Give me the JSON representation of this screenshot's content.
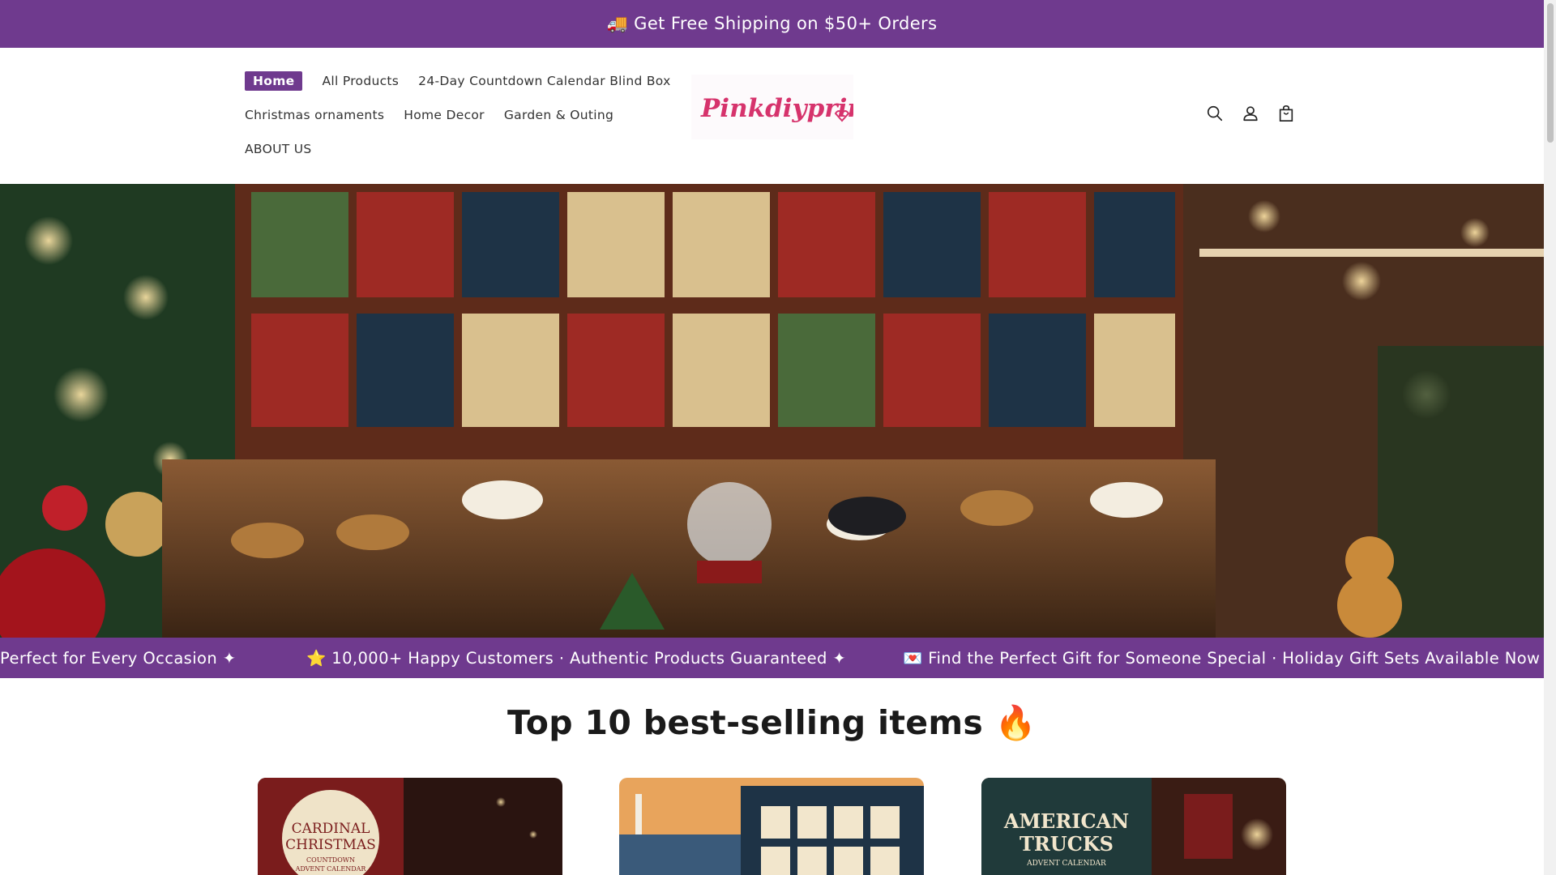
{
  "announcement": {
    "icon": "truck-icon",
    "text": "🚚 Get Free Shipping on $50+ Orders"
  },
  "nav": {
    "row1": [
      "Home",
      "All Products",
      "24-Day Countdown Calendar Blind Box"
    ],
    "row2": [
      "Christmas ornaments",
      "Home Decor",
      "Garden & Outing"
    ],
    "row3": [
      "ABOUT US"
    ]
  },
  "logo": {
    "text": "Pinkdiyprint"
  },
  "header_icons": [
    "search-icon",
    "account-icon",
    "cart-icon"
  ],
  "marquee": {
    "item1": "Perfect for Every Occasion ✦",
    "item2": "⭐ 10,000+ Happy Customers · Authentic Products Guaranteed ✦",
    "item3": "💌 Find the Perfect Gift for Someone Special · Holiday Gift Sets Available Now ✦"
  },
  "section": {
    "title": "Top 10 best-selling items 🔥"
  },
  "products": [
    {
      "image_text_1": "CARDINAL",
      "image_text_2": "CHRISTMAS",
      "image_text_3": "COUNTDOWN",
      "image_text_4": "ADVENT CALENDAR"
    },
    {
      "image_text_1": ""
    },
    {
      "image_text_1": "AMERICAN",
      "image_text_2": "TRUCKS",
      "image_text_3": "ADVENT CALENDAR"
    }
  ],
  "colors": {
    "brand": "#6f3a8e",
    "logo_pink": "#d6336c"
  }
}
